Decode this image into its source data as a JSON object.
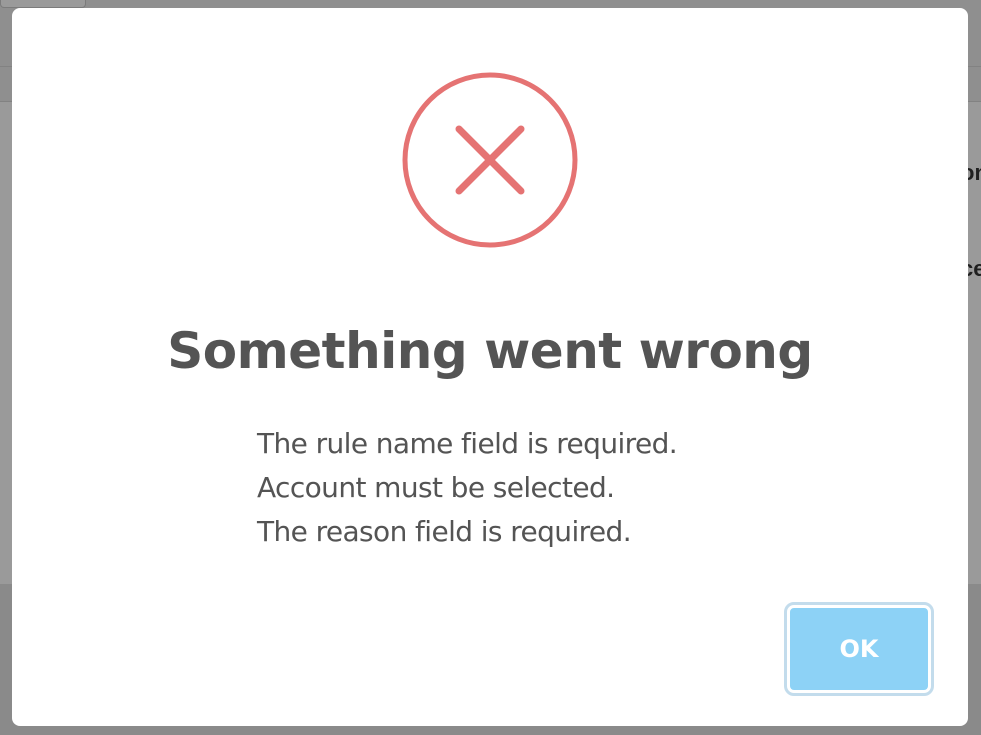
{
  "background": {
    "right_text_1": "on",
    "right_text_2": "ce"
  },
  "dialog": {
    "icon": "error-x-circle-icon",
    "icon_color": "#e57373",
    "title": "Something went wrong",
    "messages": [
      "The rule name field is required.",
      "Account must be selected.",
      "The reason field is required."
    ],
    "confirm_label": "OK",
    "confirm_color": "#8dd2f6"
  }
}
